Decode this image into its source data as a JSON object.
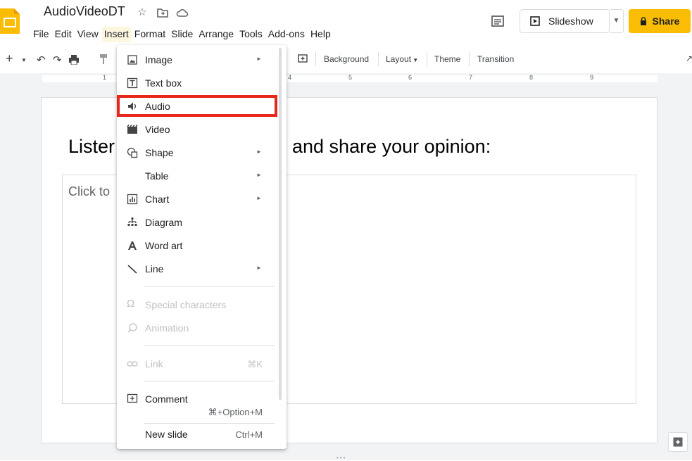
{
  "header": {
    "doc_title": "AudioVideoDT",
    "menus": [
      "File",
      "Edit",
      "View",
      "Insert",
      "Format",
      "Slide",
      "Arrange",
      "Tools",
      "Add-ons",
      "Help"
    ],
    "slideshow_label": "Slideshow",
    "share_label": "Share"
  },
  "toolbar": {
    "background_label": "Background",
    "layout_label": "Layout",
    "theme_label": "Theme",
    "transition_label": "Transition"
  },
  "ruler": {
    "numbers": [
      "1",
      "4",
      "5",
      "6",
      "7",
      "8",
      "9"
    ]
  },
  "slide": {
    "title_left": "Lister",
    "title_right": "and share your opinion:",
    "body_placeholder": "Click to"
  },
  "insert_menu": {
    "items": [
      {
        "label": "Image",
        "icon": "image-icon",
        "submenu": true
      },
      {
        "label": "Text box",
        "icon": "text-box-icon",
        "submenu": false
      },
      {
        "label": "Audio",
        "icon": "audio-icon",
        "submenu": false
      },
      {
        "label": "Video",
        "icon": "video-icon",
        "submenu": false
      },
      {
        "label": "Shape",
        "icon": "shape-icon",
        "submenu": true
      },
      {
        "label": "Table",
        "icon": "",
        "submenu": true
      },
      {
        "label": "Chart",
        "icon": "chart-icon",
        "submenu": true
      },
      {
        "label": "Diagram",
        "icon": "diagram-icon",
        "submenu": false
      },
      {
        "label": "Word art",
        "icon": "word-art-icon",
        "submenu": false
      },
      {
        "label": "Line",
        "icon": "line-icon",
        "submenu": true
      },
      {
        "label": "Special characters",
        "icon": "omega-icon",
        "disabled": true
      },
      {
        "label": "Animation",
        "icon": "animation-icon",
        "disabled": true
      },
      {
        "label": "Link",
        "icon": "link-icon",
        "disabled": true,
        "shortcut": "⌘K"
      },
      {
        "label": "Comment",
        "icon": "comment-icon",
        "shortcut": "⌘+Option+M"
      },
      {
        "label": "New slide",
        "icon": "",
        "shortcut": "Ctrl+M"
      }
    ],
    "highlighted": "Audio"
  },
  "colors": {
    "share_bg": "#fbbc04",
    "highlight_border": "#e8261a",
    "logo": "#fbbc04"
  }
}
